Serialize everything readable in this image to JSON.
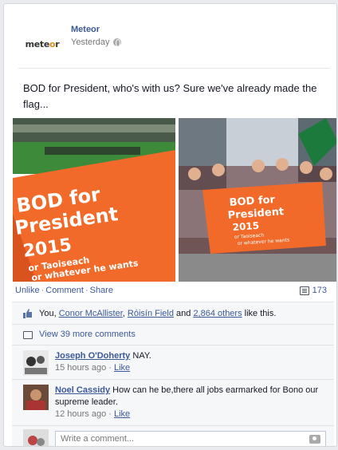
{
  "post": {
    "author": "Meteor",
    "logo_text_a": "mete",
    "logo_text_b": "o",
    "logo_text_c": "r",
    "time": "Yesterday",
    "message": "BOD for President, who's with us? Sure we've already made the flag..."
  },
  "photo_left": {
    "line1": "BOD for",
    "line2": "President",
    "line3": "2015",
    "line4": "or Taoiseach",
    "line5": "or whatever he wants"
  },
  "photo_right": {
    "line1": "BOD for",
    "line2": "President",
    "line3": "2015",
    "line4": "or Taoiseach",
    "line5": "or whatever he wants"
  },
  "actions": {
    "unlike": "Unlike",
    "comment": "Comment",
    "share": "Share",
    "comment_count": "173"
  },
  "likes": {
    "prefix": "You, ",
    "person1": "Conor McAllister",
    "sep": ", ",
    "person2": "Róisín Field",
    "and": " and ",
    "others": "2,864 others",
    "suffix": " like this."
  },
  "view_more": "View 39 more comments",
  "comments": [
    {
      "name": "Joseph O'Doherty",
      "text": " NAY.",
      "time": "15 hours ago",
      "like": "Like"
    },
    {
      "name": "Noel Cassidy",
      "text": " How can he be,there all jobs earmarked for Bono our supreme leader.",
      "time": "12 hours ago",
      "like": "Like"
    }
  ],
  "composer": {
    "placeholder": "Write a comment..."
  },
  "colors": {
    "link": "#3b5998",
    "flag": "#f26a2a"
  }
}
